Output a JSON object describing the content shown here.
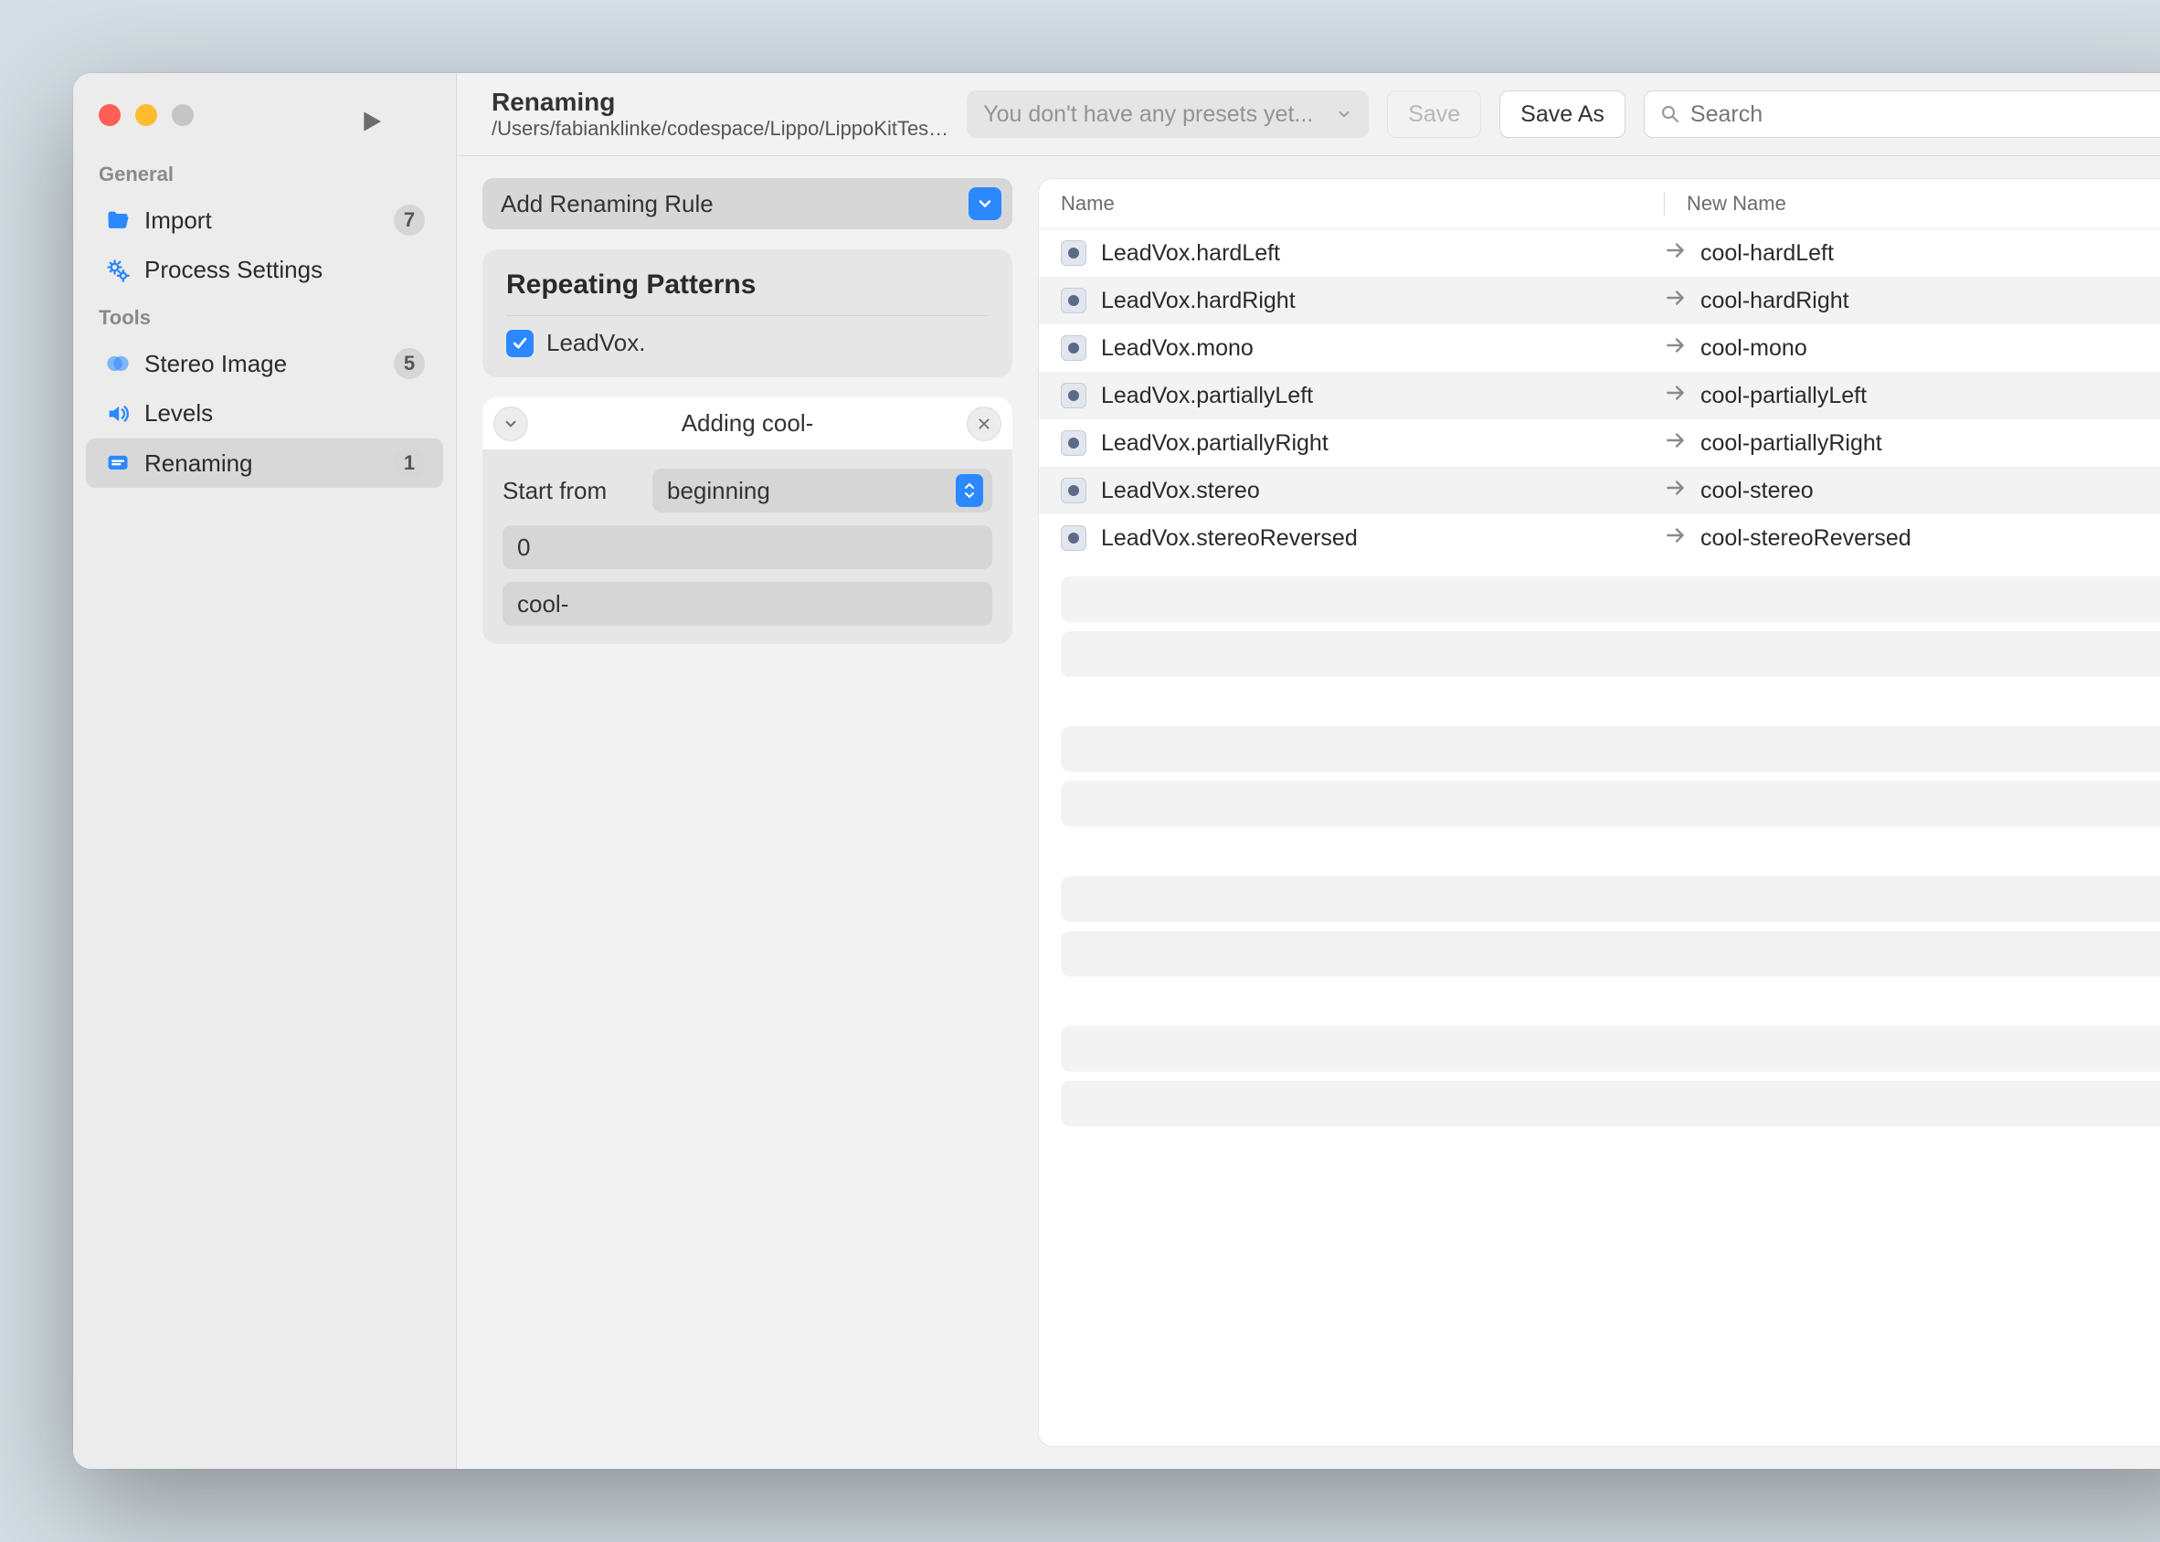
{
  "sidebar": {
    "sections": [
      {
        "label": "General",
        "items": [
          {
            "icon": "folder-open-icon",
            "label": "Import",
            "badge": "7"
          },
          {
            "icon": "gears-icon",
            "label": "Process Settings",
            "badge": ""
          }
        ]
      },
      {
        "label": "Tools",
        "items": [
          {
            "icon": "stereo-icon",
            "label": "Stereo Image",
            "badge": "5"
          },
          {
            "icon": "speaker-icon",
            "label": "Levels",
            "badge": ""
          },
          {
            "icon": "rename-icon",
            "label": "Renaming",
            "badge": "1",
            "active": true
          }
        ]
      }
    ]
  },
  "toolbar": {
    "title": "Renaming",
    "path": "/Users/fabianklinke/codespace/Lippo/LippoKitTes…",
    "preset_placeholder": "You don't have any presets yet...",
    "save_label": "Save",
    "saveas_label": "Save As",
    "search_placeholder": "Search"
  },
  "rules": {
    "add_rule_label": "Add Renaming Rule",
    "patterns_title": "Repeating Patterns",
    "patterns": [
      {
        "checked": true,
        "text": "LeadVox."
      }
    ],
    "ruleA": {
      "title": "Adding cool-",
      "start_from_label": "Start from",
      "start_from_value": "beginning",
      "index_value": "0",
      "text_value": "cool-"
    }
  },
  "preview": {
    "col_name": "Name",
    "col_newname": "New Name",
    "rows": [
      {
        "name": "LeadVox.hardLeft",
        "new": "cool-hardLeft"
      },
      {
        "name": "LeadVox.hardRight",
        "new": "cool-hardRight"
      },
      {
        "name": "LeadVox.mono",
        "new": "cool-mono"
      },
      {
        "name": "LeadVox.partiallyLeft",
        "new": "cool-partiallyLeft"
      },
      {
        "name": "LeadVox.partiallyRight",
        "new": "cool-partiallyRight"
      },
      {
        "name": "LeadVox.stereo",
        "new": "cool-stereo"
      },
      {
        "name": "LeadVox.stereoReversed",
        "new": "cool-stereoReversed"
      }
    ],
    "empty_pairs": 4
  }
}
